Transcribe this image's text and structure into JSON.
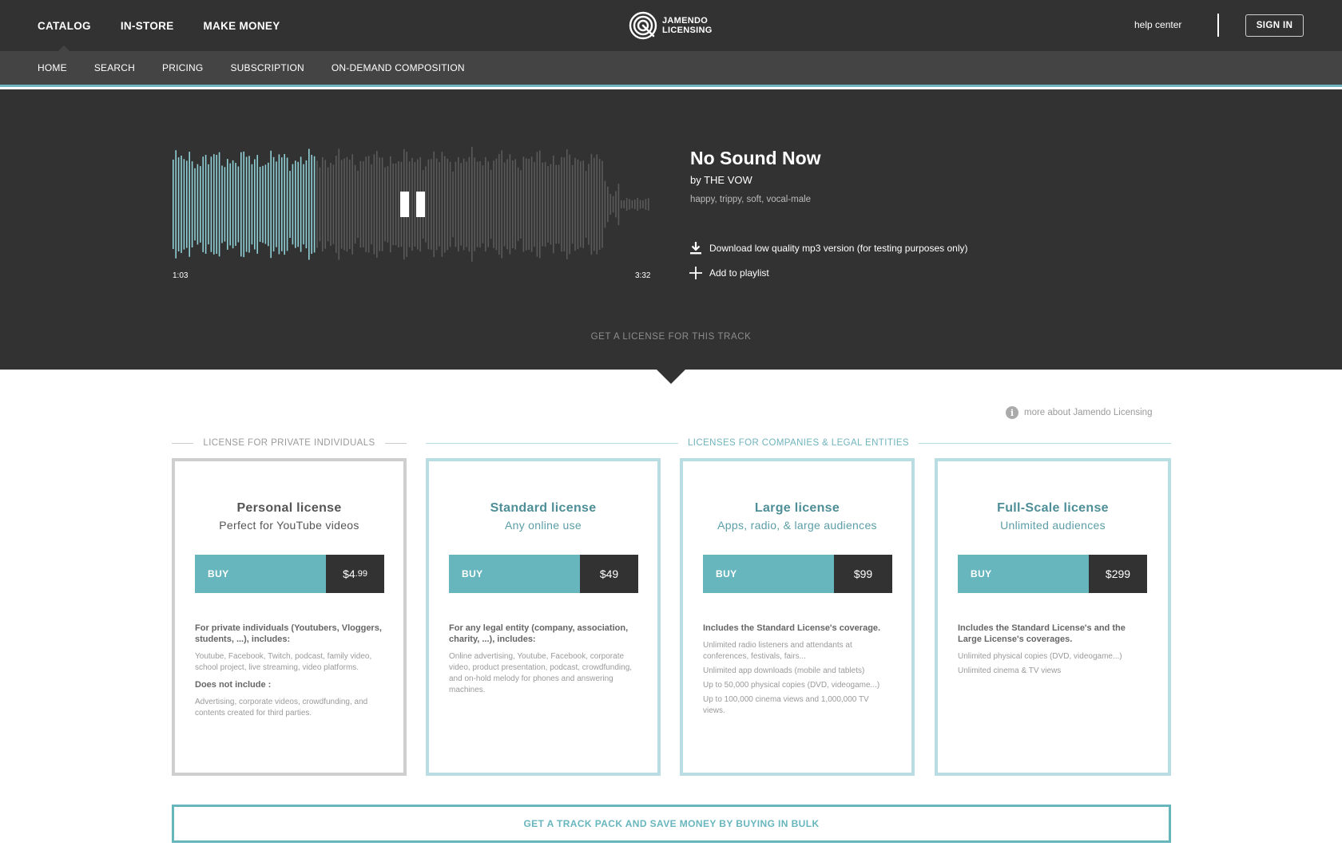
{
  "header": {
    "main_nav": [
      "CATALOG",
      "IN-STORE",
      "MAKE MONEY"
    ],
    "brand_line1": "JAMENDO",
    "brand_line2": "LICENSING",
    "help_link": "help center",
    "sign_in": "SIGN IN"
  },
  "subnav": [
    "HOME",
    "SEARCH",
    "PRICING",
    "SUBSCRIPTION",
    "ON-DEMAND COMPOSITION"
  ],
  "player": {
    "title": "No Sound Now",
    "artist": "by THE VOW",
    "tags": "happy, trippy, soft, vocal-male",
    "time_elapsed": "1:03",
    "time_total": "3:32",
    "progress": 0.297,
    "download_label": "Download low quality mp3 version (for testing purposes only)",
    "playlist_label": "Add to playlist",
    "get_license": "GET A LICENSE FOR THIS TRACK",
    "colors": {
      "played": "#8fd0d6",
      "unplayed": "#5a5a5a"
    }
  },
  "licenses": {
    "more_about": "more about Jamendo Licensing",
    "private_heading": "LICENSE FOR PRIVATE INDIVIDUALS",
    "company_heading": "LICENSES FOR COMPANIES & LEGAL ENTITIES",
    "buy_label": "BUY",
    "personal": {
      "name": "Personal license",
      "subtitle": "Perfect for YouTube videos",
      "price_main": "$4",
      "price_cents": ".99",
      "lead": "For private individuals (Youtubers, Vloggers, students, ...), includes:",
      "details": "Youtube, Facebook, Twitch, podcast, family video, school project, live streaming, video platforms.",
      "exclude_title": "Does not include :",
      "exclude_details": "Advertising, corporate videos, crowdfunding, and contents created for third parties."
    },
    "standard": {
      "name": "Standard license",
      "subtitle": "Any online use",
      "price": "$49",
      "lead": "For any legal entity (company, association, charity, ...), includes:",
      "details": "Online advertising, Youtube, Facebook, corporate video, product presentation, podcast, crowdfunding, and on-hold melody for phones and answering machines."
    },
    "large": {
      "name": "Large license",
      "subtitle": "Apps, radio, & large audiences",
      "price": "$99",
      "lead": "Includes the Standard License's coverage.",
      "details": [
        "Unlimited radio listeners and attendants at conferences, festivals, fairs...",
        "Unlimited app downloads (mobile and tablets)",
        "Up to 50,000 physical copies (DVD, videogame...)",
        "Up to 100,000 cinema views and 1,000,000 TV views."
      ]
    },
    "fullscale": {
      "name": "Full-Scale license",
      "subtitle": "Unlimited audiences",
      "price": "$299",
      "lead": "Includes the Standard License's and the Large License's coverages.",
      "details": [
        "Unlimited physical copies (DVD, videogame...)",
        "Unlimited cinema & TV views"
      ]
    }
  },
  "bulk_button": "GET A TRACK PACK AND SAVE MONEY BY BUYING IN BULK",
  "colors": {
    "header_bg": "#323232",
    "subnav_bg": "#444444",
    "accent": "#67b5bd",
    "accent_light": "#b9dde2",
    "price_bg": "#323232"
  }
}
